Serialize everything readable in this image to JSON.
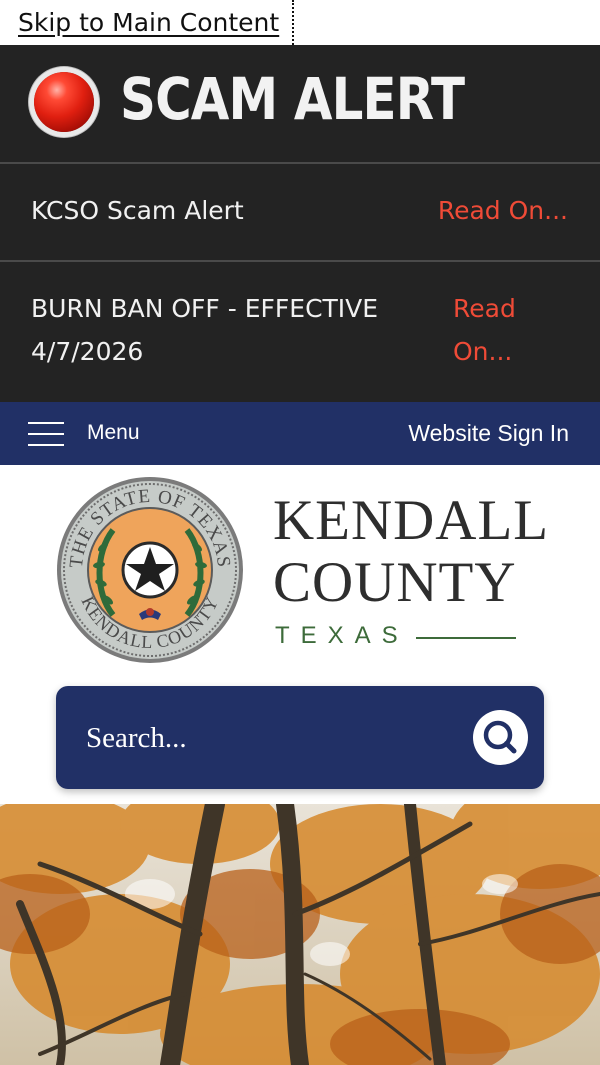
{
  "skip_link": {
    "label": "Skip to Main Content"
  },
  "alert_banner": {
    "title": "SCAM ALERT",
    "items": [
      {
        "text": "KCSO Scam Alert",
        "link": "Read On..."
      },
      {
        "text": "BURN BAN OFF - EFFECTIVE 4/7/2026",
        "link": "Read On..."
      }
    ],
    "colors": {
      "background": "#232323",
      "link": "#ef4b37",
      "indicator": "#e01f10"
    }
  },
  "navbar": {
    "menu_label": "Menu",
    "sign_in_label": "Website Sign In",
    "colors": {
      "background": "#213066"
    }
  },
  "logo": {
    "name_line1": "KENDALL",
    "name_line2": "COUNTY",
    "state": "TEXAS",
    "seal_text_top": "THE STATE OF TEXAS",
    "seal_text_bottom": "KENDALL COUNTY"
  },
  "search": {
    "placeholder": "Search...",
    "icon": "search-icon"
  },
  "hero": {
    "icon": "autumn-trees-photo"
  }
}
